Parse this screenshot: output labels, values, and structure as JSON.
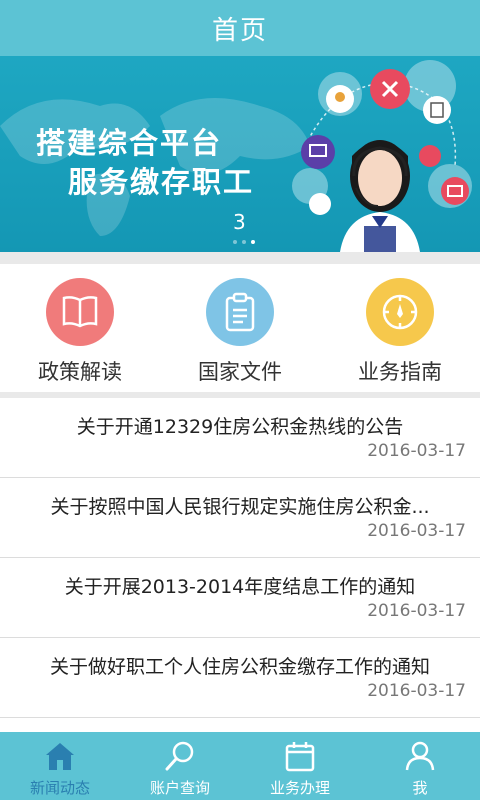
{
  "header": {
    "title": "首页"
  },
  "banner": {
    "slogan_line1": "搭建综合平台",
    "slogan_line2": "服务缴存职工",
    "page_number": "3"
  },
  "categories": [
    {
      "label": "政策解读",
      "icon": "open-book-icon",
      "color": "#f07b7b"
    },
    {
      "label": "国家文件",
      "icon": "clipboard-icon",
      "color": "#7fc4e6"
    },
    {
      "label": "业务指南",
      "icon": "compass-icon",
      "color": "#f6c84c"
    }
  ],
  "news": [
    {
      "title": "关于开通12329住房公积金热线的公告",
      "date": "2016-03-17"
    },
    {
      "title": "关于按照中国人民银行规定实施住房公积金...",
      "date": "2016-03-17"
    },
    {
      "title": "关于开展2013-2014年度结息工作的通知",
      "date": "2016-03-17"
    },
    {
      "title": "关于做好职工个人住房公积金缴存工作的通知",
      "date": "2016-03-17"
    }
  ],
  "tabbar": [
    {
      "label": "新闻动态",
      "icon": "home-icon",
      "active": true
    },
    {
      "label": "账户查询",
      "icon": "search-icon",
      "active": false
    },
    {
      "label": "业务办理",
      "icon": "calendar-icon",
      "active": false
    },
    {
      "label": "我",
      "icon": "user-icon",
      "active": false
    }
  ],
  "colors": {
    "primary": "#5cc3d4",
    "banner": "#1ea7c2",
    "active_tab": "#2a7fb0"
  }
}
